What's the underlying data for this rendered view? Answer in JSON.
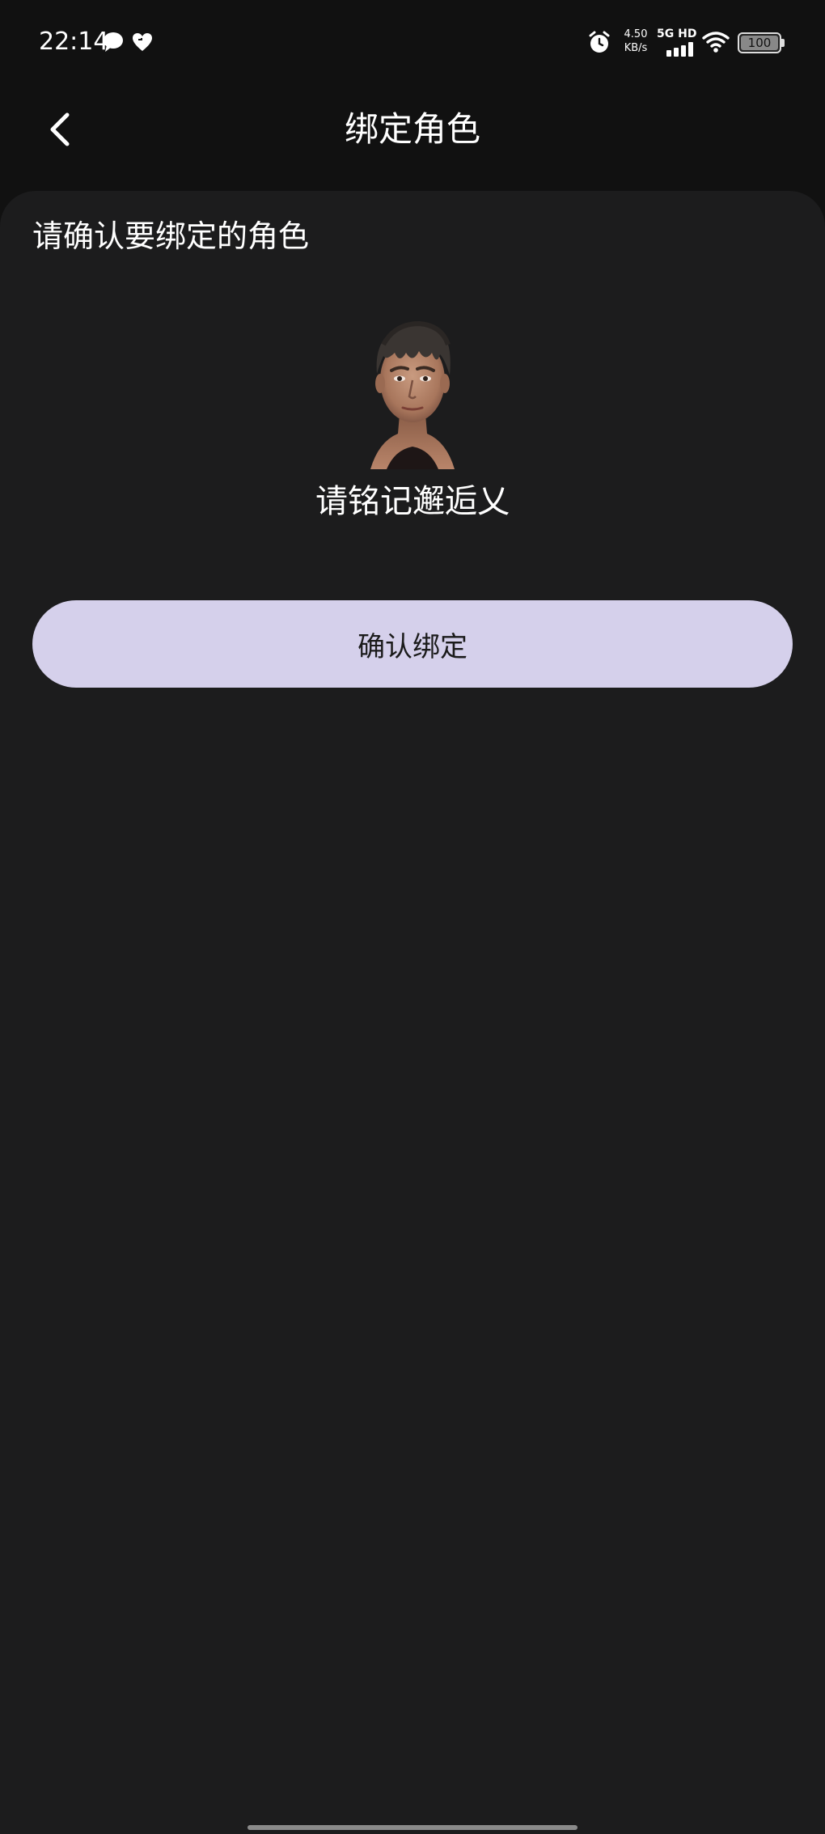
{
  "status_bar": {
    "time": "22:14",
    "left_icons": [
      "chat-bubble-icon",
      "heart-icon"
    ],
    "net_speed_value": "4.50",
    "net_speed_unit": "KB/s",
    "network_type": "5G HD",
    "battery": "100",
    "right_icons": [
      "alarm-icon",
      "signal-icon",
      "wifi-icon",
      "battery-icon"
    ]
  },
  "header": {
    "title": "绑定角色",
    "back_icon": "chevron-left-icon"
  },
  "card": {
    "prompt": "请确认要绑定的角色",
    "role_name": "请铭记邂逅乂",
    "confirm_label": "确认绑定"
  },
  "colors": {
    "background": "#111111",
    "card": "#1c1c1d",
    "button": "#d5d0eb",
    "button_text": "#1b1b1b",
    "text": "#ffffff"
  }
}
